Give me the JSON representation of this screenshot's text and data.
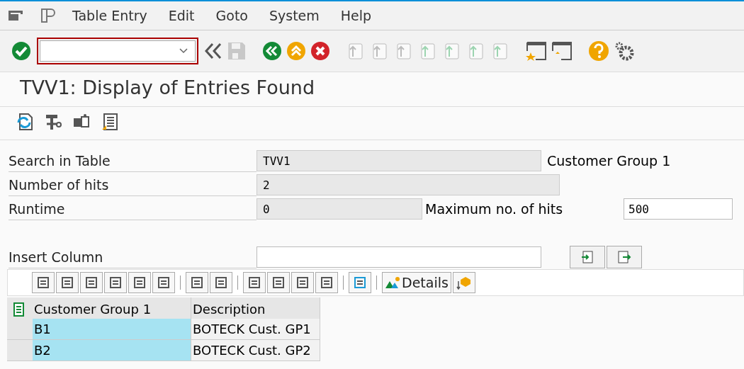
{
  "menu": [
    "Table Entry",
    "Edit",
    "Goto",
    "System",
    "Help"
  ],
  "title": "TVV1: Display of Entries Found",
  "fields": [
    {
      "label": "Search in Table",
      "value": "TVV1",
      "note": "Customer Group 1"
    },
    {
      "label": "Number of hits",
      "value": "2"
    },
    {
      "label": "Runtime",
      "value": "0",
      "extra_label": "Maximum no. of hits",
      "extra_value": "500"
    }
  ],
  "insert_column": {
    "label": "Insert Column"
  },
  "details_button": "Details",
  "table": {
    "columns": [
      "Customer Group 1",
      "Description"
    ],
    "rows": [
      [
        "B1",
        "BOTECK Cust. GP1"
      ],
      [
        "B2",
        "BOTECK Cust. GP2"
      ]
    ]
  }
}
